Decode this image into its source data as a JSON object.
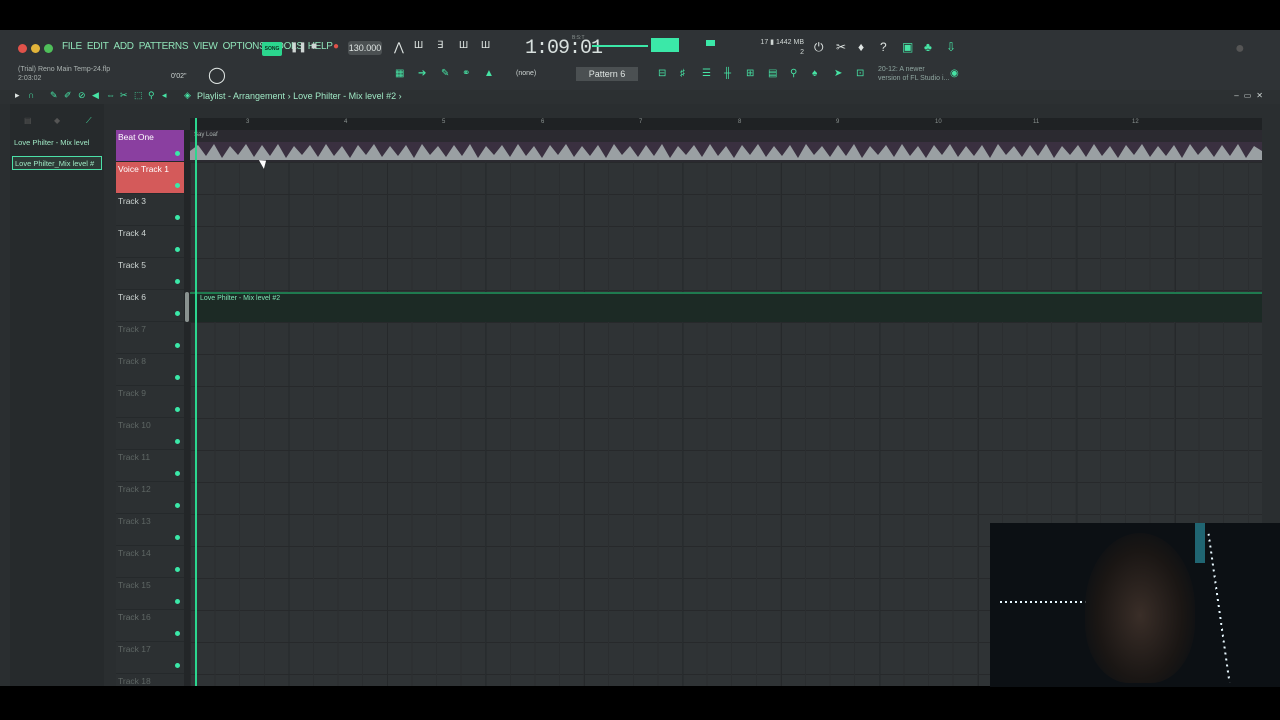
{
  "menu": [
    "FILE",
    "EDIT",
    "ADD",
    "PATTERNS",
    "VIEW",
    "OPTIONS",
    "TOOLS",
    "HELP"
  ],
  "project": {
    "name": "(Trial) Reno Main Temp-24.flp",
    "time": "2:03:02",
    "hint_time": "0'02\""
  },
  "transport": {
    "mode_label": "SONG",
    "tempo": "130.000",
    "time": "1:09:01",
    "time_label": "B:S:T"
  },
  "cpu": {
    "memory": "1442 MB",
    "cpu": "17",
    "voices": "2"
  },
  "pattern": {
    "selector": "(none)",
    "current": "Pattern 6"
  },
  "update_hint": {
    "line1": "20-12: A newer",
    "line2": "version of FL Studio i..."
  },
  "playlist": {
    "title": "Playlist - Arrangement",
    "crumb": "Love Philter - Mix level #2"
  },
  "browser": [
    {
      "label": "Love Philter - Mix level"
    },
    {
      "label": "Love Philter_Mix level #"
    }
  ],
  "tracks": [
    {
      "name": "Beat One",
      "color": "#8a3fa0"
    },
    {
      "name": "Voice Track 1",
      "color": "#d45a5a"
    },
    {
      "name": "Track 3"
    },
    {
      "name": "Track 4"
    },
    {
      "name": "Track 5"
    },
    {
      "name": "Track 6"
    },
    {
      "name": "Track 7"
    },
    {
      "name": "Track 8"
    },
    {
      "name": "Track 9"
    },
    {
      "name": "Track 10"
    },
    {
      "name": "Track 11"
    },
    {
      "name": "Track 12"
    },
    {
      "name": "Track 13"
    },
    {
      "name": "Track 14"
    },
    {
      "name": "Track 15"
    },
    {
      "name": "Track 16"
    },
    {
      "name": "Track 17"
    },
    {
      "name": "Track 18"
    }
  ],
  "ruler": [
    "3",
    "4",
    "5",
    "6",
    "7",
    "8",
    "9",
    "10",
    "11",
    "12"
  ],
  "clips": {
    "audio": "Say Loaf",
    "automation": "Love Philter - Mix level #2"
  },
  "colors": {
    "accent": "#3be8a8",
    "menu": "#8fe3b8"
  }
}
